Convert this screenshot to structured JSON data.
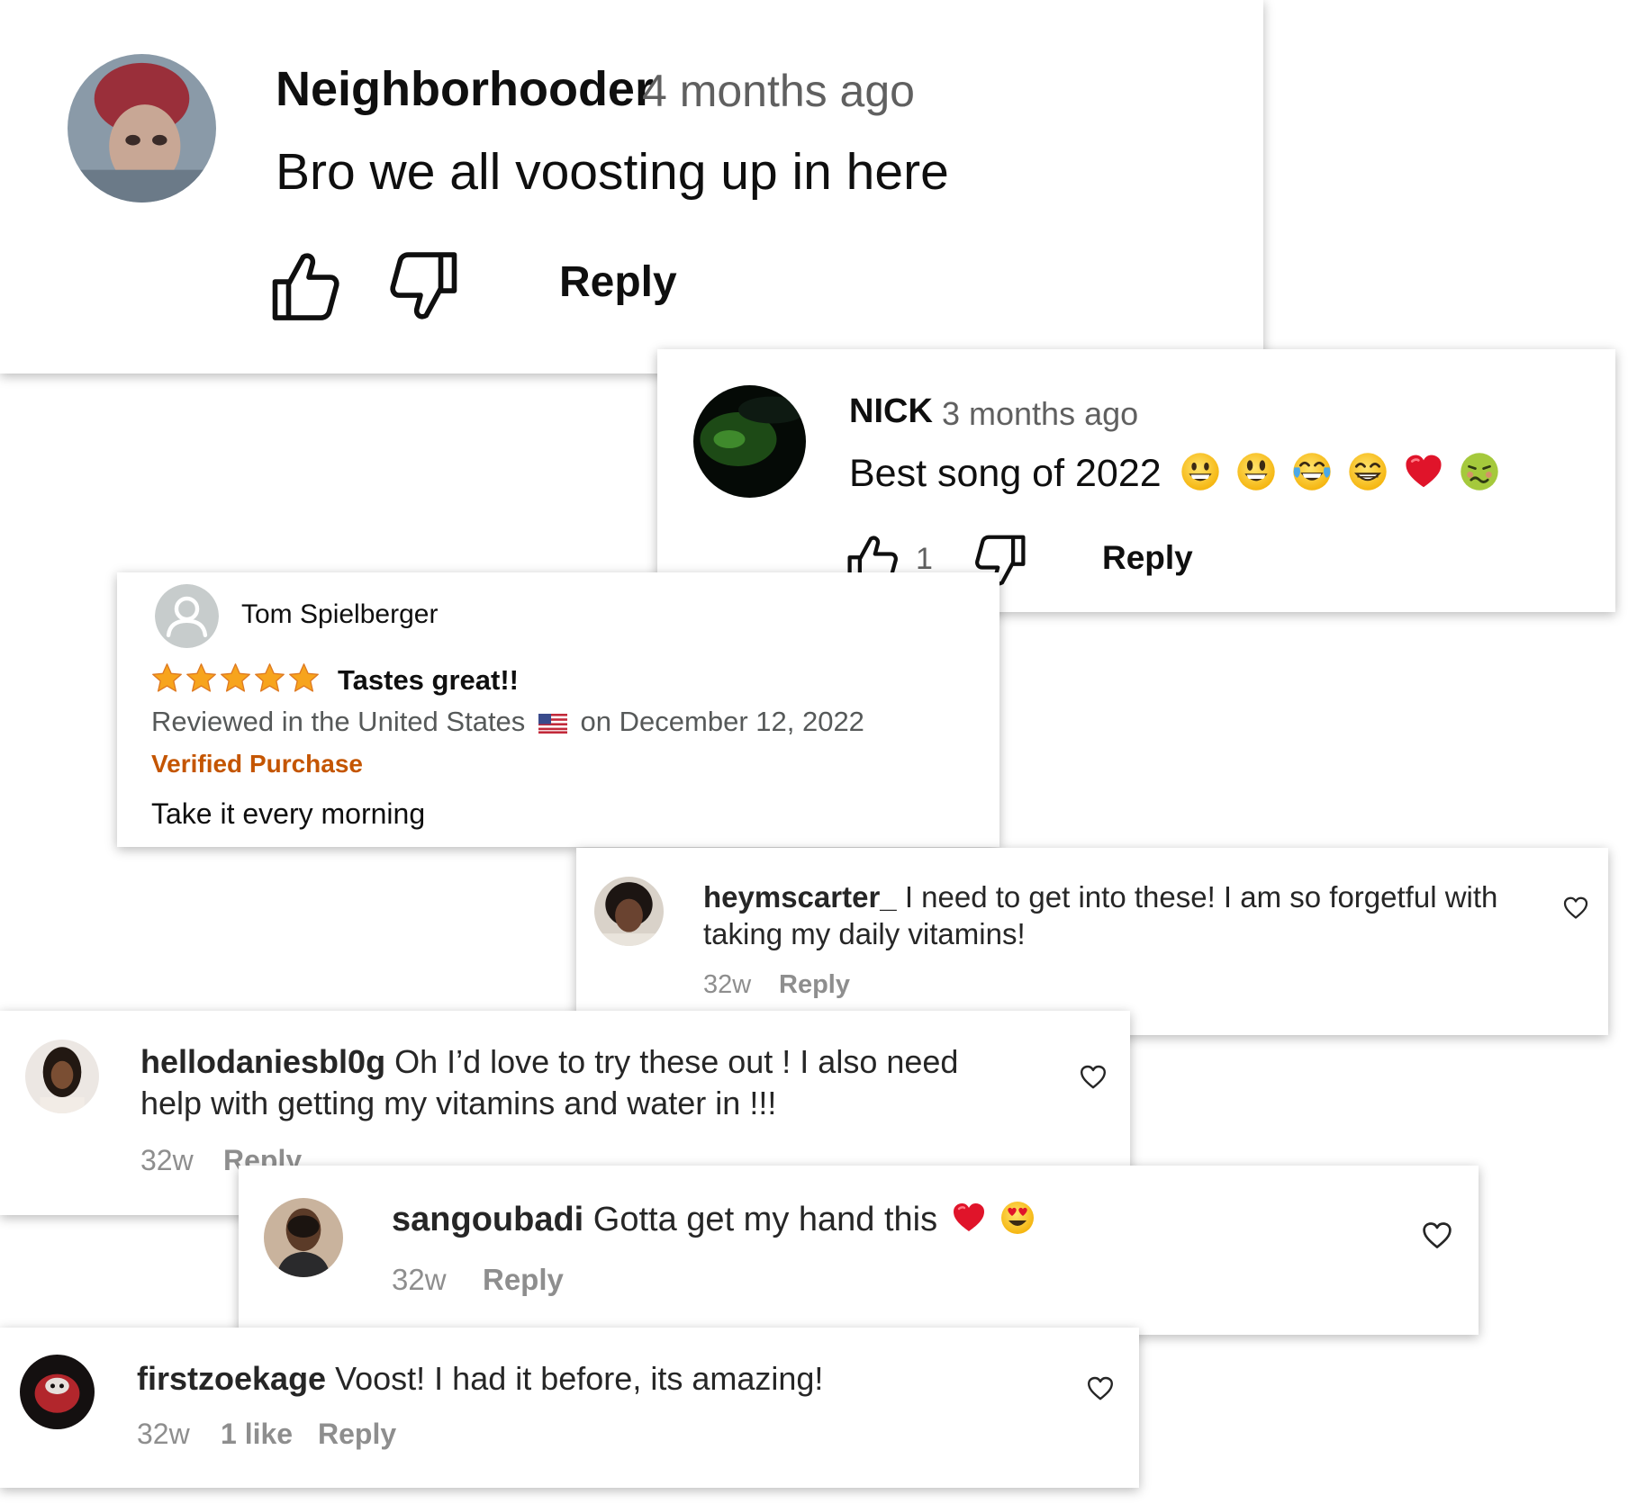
{
  "youtube_comments": [
    {
      "username": "Neighborhooder",
      "time": "4 months ago",
      "text": "Bro we all voosting up in here",
      "like_count": "",
      "reply_label": "Reply",
      "icons": [
        "thumbs-up-icon",
        "thumbs-down-icon"
      ]
    },
    {
      "username": "NICK",
      "time": "3 months ago",
      "text": "Best song of 2022",
      "emojis": [
        "grinning-face",
        "grinning-face-big-eyes",
        "face-with-tears-of-joy",
        "beaming-face",
        "red-heart",
        "nauseated-face"
      ],
      "like_count": "1",
      "reply_label": "Reply",
      "icons": [
        "thumbs-up-icon",
        "thumbs-down-icon"
      ]
    }
  ],
  "amazon_review": {
    "reviewer": "Tom Spielberger",
    "rating": 5,
    "max_rating": 5,
    "title": "Tastes great!!",
    "meta_prefix": "Reviewed in the United States",
    "meta_suffix": "on December 12, 2022",
    "verified_label": "Verified Purchase",
    "body": "Take it every morning",
    "colors": {
      "star": "#f7a41d",
      "verified": "#c45500",
      "meta": "#565959"
    }
  },
  "instagram_comments": [
    {
      "username": "heymscarter_",
      "text_line1": "I need to get into these! I am so forgetful with",
      "text_line2": "taking my daily vitamins!",
      "time": "32w",
      "reply_label": "Reply"
    },
    {
      "username": "hellodaniesbl0g",
      "text_line1": "Oh I’d love to try these out ! I also need",
      "text_line2": "help with getting my vitamins and water in !!!",
      "time": "32w",
      "reply_label": "Reply"
    },
    {
      "username": "sangoubadi",
      "text_line1": "Gotta get my hand this",
      "emojis": [
        "red-heart",
        "smiling-face-with-heart-eyes"
      ],
      "time": "32w",
      "reply_label": "Reply"
    },
    {
      "username": "firstzoekage",
      "text_line1": "Voost! I had it before, its amazing!",
      "time": "32w",
      "likes_label": "1 like",
      "reply_label": "Reply"
    }
  ]
}
